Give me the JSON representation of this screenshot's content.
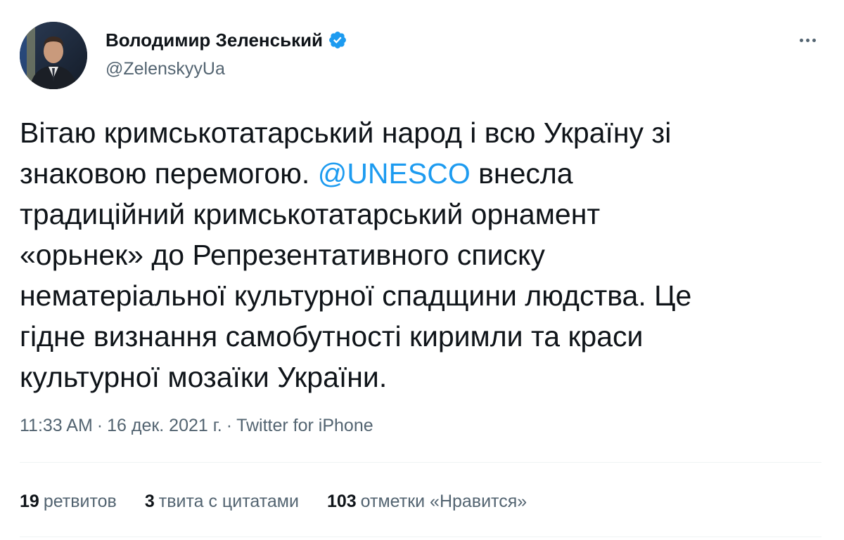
{
  "author": {
    "display_name": "Володимир Зеленський",
    "handle": "@ZelenskyyUa",
    "verified_icon": "verified-badge-icon",
    "avatar": "profile-photo"
  },
  "tweet": {
    "lines": [
      {
        "text": "Вітаю кримськотатарський народ і всю Україну зі"
      },
      {
        "before": "знаковою перемогою. ",
        "mention": "@UNESCO",
        "after": " внесла"
      },
      {
        "text": "традиційний кримськотатарський орнамент"
      },
      {
        "text": "«орьнек» до Репрезентативного списку"
      },
      {
        "text": "нематеріальної культурної спадщини людства. Це"
      },
      {
        "text": "гідне визнання самобутності киримли та краси"
      },
      {
        "text": "культурної мозаїки України."
      }
    ]
  },
  "meta": {
    "time": "11:33 AM",
    "separator": "·",
    "date": "16 дек. 2021 г.",
    "source": "Twitter for iPhone"
  },
  "stats": {
    "retweets_count": "19",
    "retweets_label": "ретвитов",
    "quotes_count": "3",
    "quotes_label": "твита с цитатами",
    "likes_count": "103",
    "likes_label": "отметки «Нравится»"
  },
  "colors": {
    "text": "#0f1419",
    "secondary": "#536471",
    "link": "#1d9bf0",
    "divider": "#eff3f4",
    "verified": "#1d9bf0"
  }
}
